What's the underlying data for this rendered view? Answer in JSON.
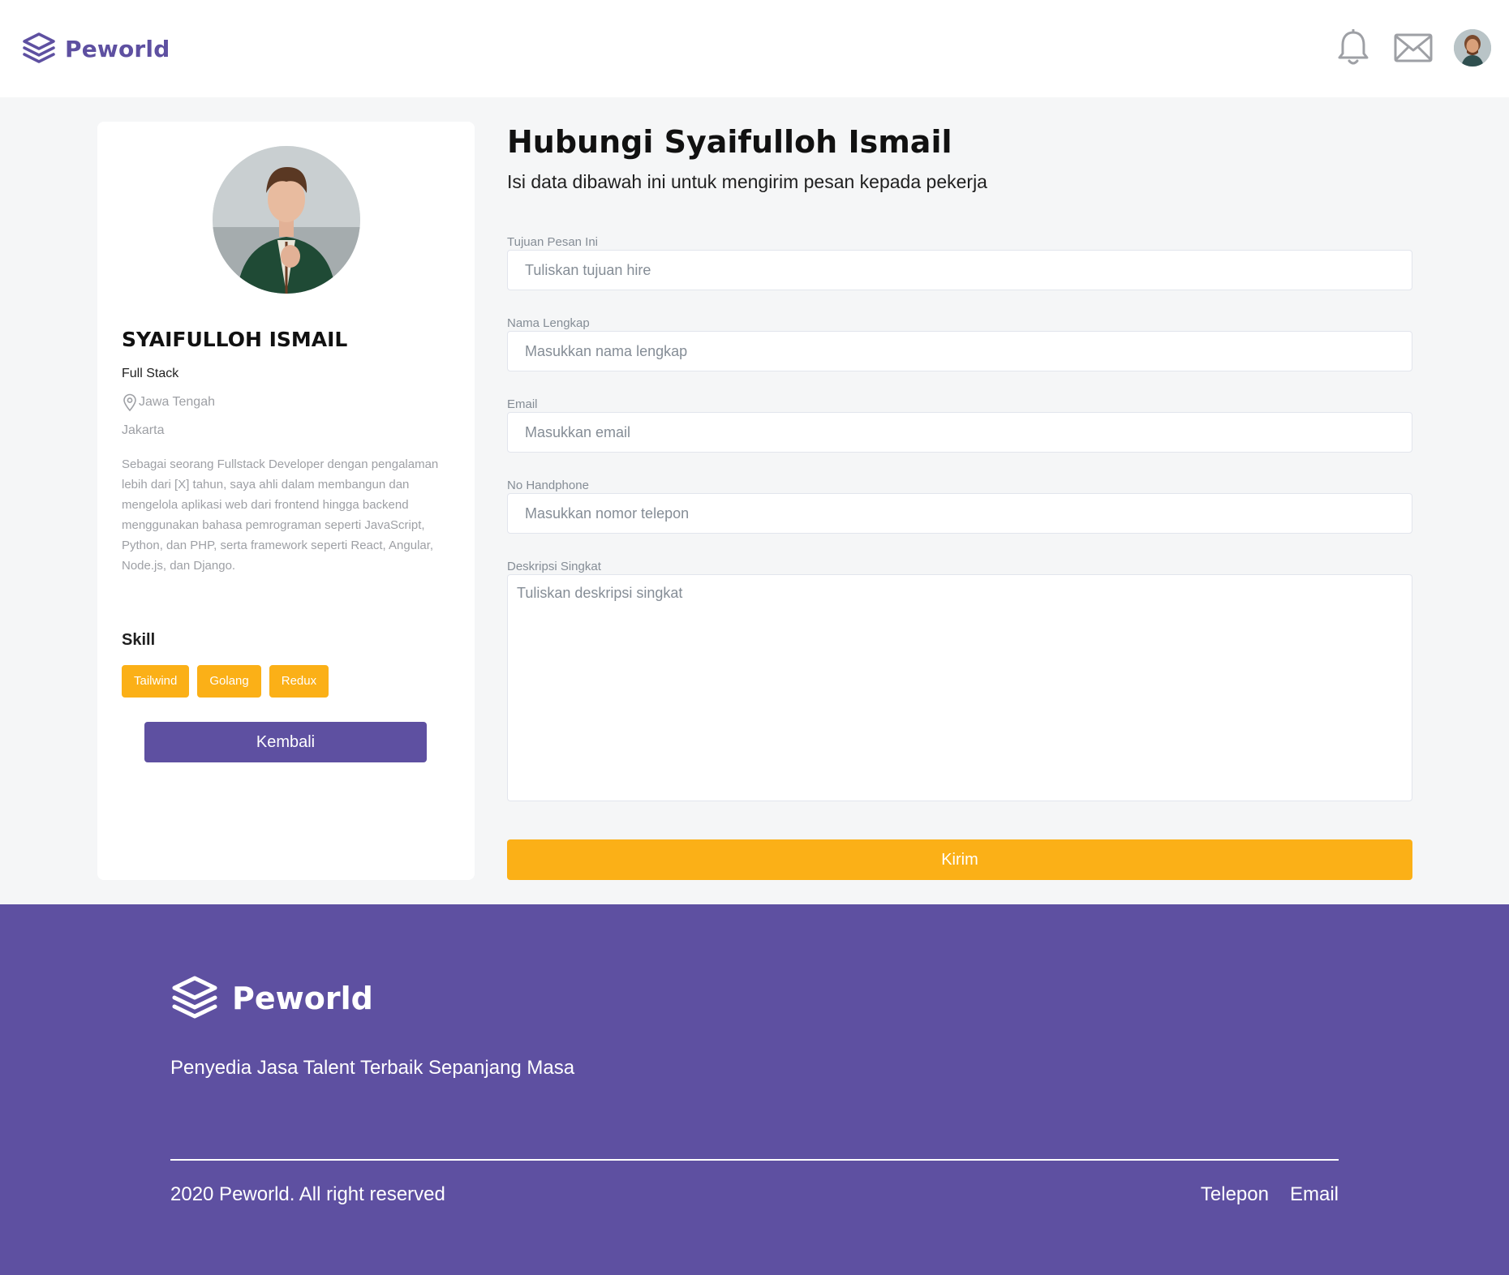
{
  "navbar": {
    "brand_name": "Peworld",
    "icons": [
      "layers-logo-icon",
      "bell-icon",
      "mail-icon",
      "user-avatar"
    ]
  },
  "profile": {
    "name": "SYAIFULLOH ISMAIL",
    "job": "Full Stack",
    "location": "Jawa Tengah",
    "city": "Jakarta",
    "description": "Sebagai seorang Fullstack Developer dengan pengalaman lebih dari [X] tahun, saya ahli dalam membangun dan mengelola aplikasi web dari frontend hingga backend menggunakan bahasa pemrograman seperti JavaScript, Python, dan PHP, serta framework seperti React, Angular, Node.js, dan Django.",
    "skill_title": "Skill",
    "skills": [
      "Tailwind",
      "Golang",
      "Redux"
    ],
    "back_label": "Kembali"
  },
  "form": {
    "title": "Hubungi Syaifulloh Ismail",
    "subtitle": "Isi data dibawah ini untuk mengirim pesan kepada pekerja",
    "fields": [
      {
        "label": "Tujuan Pesan Ini",
        "placeholder": "Tuliskan tujuan hire",
        "value": ""
      },
      {
        "label": "Nama Lengkap",
        "placeholder": "Masukkan nama lengkap",
        "value": ""
      },
      {
        "label": "Email",
        "placeholder": "Masukkan email",
        "value": ""
      },
      {
        "label": "No Handphone",
        "placeholder": "Masukkan nomor telepon",
        "value": ""
      },
      {
        "label": "Deskripsi Singkat",
        "placeholder": "Tuliskan deskripsi singkat",
        "value": ""
      }
    ],
    "submit_label": "Kirim"
  },
  "footer": {
    "brand_name": "Peworld",
    "tagline": "Penyedia Jasa Talent Terbaik Sepanjang Masa",
    "copyright": "2020 Peworld. All right reserved",
    "links": [
      "Telepon",
      "Email"
    ]
  },
  "colors": {
    "primary": "#5e50a1",
    "accent": "#fbb017",
    "background": "#f5f6f7",
    "muted_text": "#9ea0a5"
  }
}
